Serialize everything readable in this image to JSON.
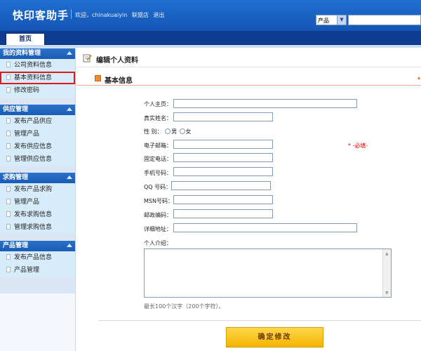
{
  "header": {
    "logo": "快印客助手",
    "welcome": "欢迎，chinakuaiyin",
    "alliance_link": "联盟店",
    "logout_link": "退出",
    "search_select_value": "产品",
    "search_input_value": ""
  },
  "nav": {
    "home_tab": "首页"
  },
  "sidebar": {
    "sections": [
      {
        "title": "我的资料管理",
        "items": [
          "公司资料信息",
          "基本资料信息",
          "修改密码"
        ]
      },
      {
        "title": "供应管理",
        "items": [
          "发布产品供应",
          "管理产品",
          "发布供应信息",
          "管理供应信息"
        ]
      },
      {
        "title": "求购管理",
        "items": [
          "发布产品求购",
          "管理产品",
          "发布求购信息",
          "管理求购信息"
        ]
      },
      {
        "title": "产品管理",
        "items": [
          "发布产品信息",
          "产品管理"
        ]
      }
    ],
    "highlighted_item": "基本资料信息"
  },
  "main": {
    "page_title": "编辑个人资料",
    "section_title": "基本信息",
    "fields": {
      "homepage_label": "个人主页：",
      "realname_label": "真实姓名：",
      "gender_label": "性 别：",
      "gender_male": "男",
      "gender_female": "女",
      "email_label": "电子邮箱：",
      "required_note": "* -必填-",
      "phone_label": "固定电话：",
      "mobile_label": "手机号码：",
      "qq_label": "QQ 号码：",
      "msn_label": "MSN号码：",
      "zip_label": "邮政编码：",
      "address_label": "详细地址：",
      "intro_label": "个人介绍："
    },
    "hint": "最长100个汉字（200个字符）。",
    "submit_label": "确定修改"
  },
  "colors": {
    "header_blue": "#1f6fd0",
    "nav_dark_blue": "#0e3d91",
    "sidebar_bg": "#d7ecfa",
    "section_accent": "#f08a2c",
    "highlight_red": "#e01a1a",
    "submit_yellow": "#ffc21a"
  }
}
